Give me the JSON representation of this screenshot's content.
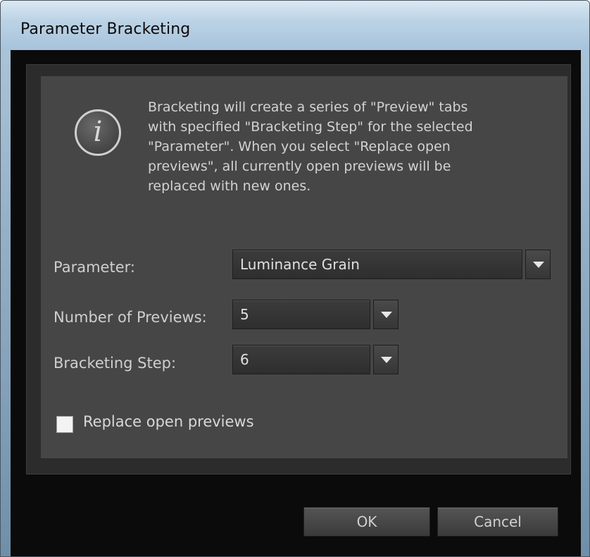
{
  "window": {
    "title": "Parameter Bracketing"
  },
  "info": {
    "icon": "info-icon",
    "icon_glyph": "i",
    "text": "Bracketing will create a series of \"Preview\" tabs\nwith specified \"Bracketing Step\" for the selected\n\"Parameter\". When you select \"Replace open\npreviews\", all currently open previews will be\nreplaced with new ones."
  },
  "form": {
    "parameter": {
      "label": "Parameter:",
      "value": "Luminance Grain"
    },
    "num_previews": {
      "label": "Number of Previews:",
      "value": "5"
    },
    "bracketing_step": {
      "label": "Bracketing Step:",
      "value": "6"
    },
    "replace_open": {
      "label": "Replace open previews",
      "checked": false
    }
  },
  "buttons": {
    "ok": "OK",
    "cancel": "Cancel"
  }
}
